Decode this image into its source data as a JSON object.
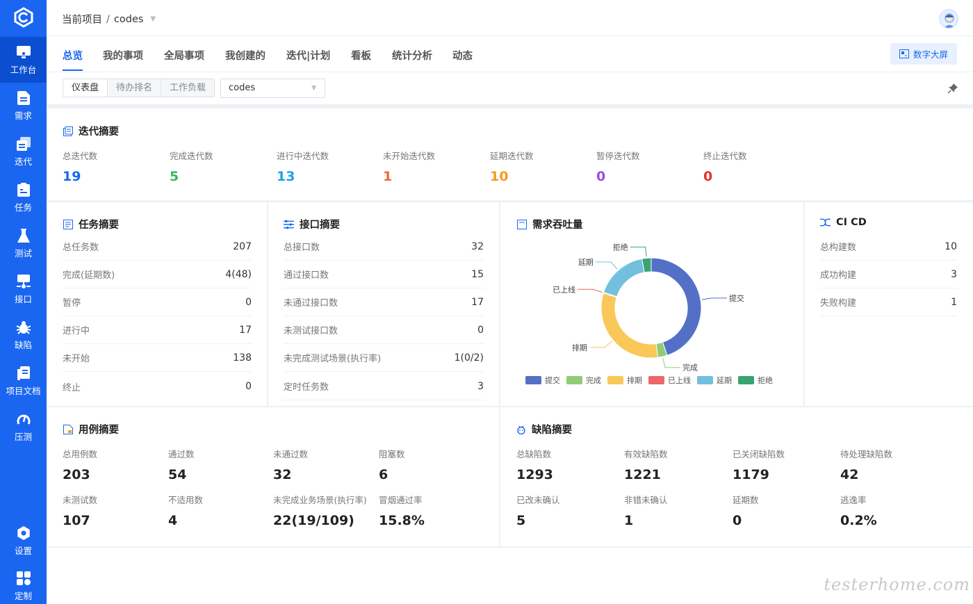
{
  "sidebar": {
    "items": [
      {
        "label": "工作台",
        "icon": "workbench-icon"
      },
      {
        "label": "需求",
        "icon": "requirement-icon"
      },
      {
        "label": "迭代",
        "icon": "iteration-icon"
      },
      {
        "label": "任务",
        "icon": "task-icon"
      },
      {
        "label": "测试",
        "icon": "test-flask-icon"
      },
      {
        "label": "接口",
        "icon": "api-icon"
      },
      {
        "label": "缺陷",
        "icon": "bug-icon"
      },
      {
        "label": "项目文档",
        "icon": "document-icon"
      },
      {
        "label": "压测",
        "icon": "gauge-icon"
      },
      {
        "label": "设置",
        "icon": "settings-icon"
      },
      {
        "label": "定制",
        "icon": "customize-icon"
      }
    ]
  },
  "header": {
    "breadcrumb_root": "当前项目",
    "breadcrumb_sep": "/",
    "project": "codes"
  },
  "tabs": [
    "总览",
    "我的事项",
    "全局事项",
    "我创建的",
    "迭代|计划",
    "看板",
    "统计分析",
    "动态"
  ],
  "screen_button": "数字大屏",
  "filter": {
    "segments": [
      "仪表盘",
      "待办排名",
      "工作负载"
    ],
    "select_value": "codes"
  },
  "iteration_summary": {
    "title": "迭代摘要",
    "stats": [
      {
        "label": "总迭代数",
        "value": "19",
        "color": "#1a66f0"
      },
      {
        "label": "完成迭代数",
        "value": "5",
        "color": "#3bb85a"
      },
      {
        "label": "进行中迭代数",
        "value": "13",
        "color": "#1aa3e8"
      },
      {
        "label": "未开始迭代数",
        "value": "1",
        "color": "#f2692c"
      },
      {
        "label": "延期迭代数",
        "value": "10",
        "color": "#f59a1b"
      },
      {
        "label": "暂停迭代数",
        "value": "0",
        "color": "#9b4ee6"
      },
      {
        "label": "终止迭代数",
        "value": "0",
        "color": "#e8302a"
      }
    ]
  },
  "task_summary": {
    "title": "任务摘要",
    "rows": [
      {
        "k": "总任务数",
        "v": "207"
      },
      {
        "k": "完成(延期数)",
        "v": "4(48)"
      },
      {
        "k": "暂停",
        "v": "0"
      },
      {
        "k": "进行中",
        "v": "17"
      },
      {
        "k": "未开始",
        "v": "138"
      },
      {
        "k": "终止",
        "v": "0"
      }
    ]
  },
  "api_summary": {
    "title": "接口摘要",
    "rows": [
      {
        "k": "总接口数",
        "v": "32"
      },
      {
        "k": "通过接口数",
        "v": "15"
      },
      {
        "k": "未通过接口数",
        "v": "17"
      },
      {
        "k": "未测试接口数",
        "v": "0"
      },
      {
        "k": "未完成测试场景(执行率)",
        "v": "1(0/2)"
      },
      {
        "k": "定时任务数",
        "v": "3"
      }
    ]
  },
  "demand_throughput": {
    "title": "需求吞吐量"
  },
  "chart_data": {
    "type": "pie",
    "donut": true,
    "title": "需求吞吐量",
    "categories": [
      "提交",
      "完成",
      "排期",
      "已上线",
      "延期",
      "拒绝"
    ],
    "values": [
      45,
      3,
      32,
      0.3,
      17,
      3
    ],
    "colors": [
      "#5470c6",
      "#91cc75",
      "#fac858",
      "#ee6666",
      "#73c0de",
      "#3ba272"
    ],
    "legend": "bottom"
  },
  "cicd": {
    "title": "CI CD",
    "rows": [
      {
        "k": "总构建数",
        "v": "10"
      },
      {
        "k": "成功构建",
        "v": "3"
      },
      {
        "k": "失败构建",
        "v": "1"
      }
    ]
  },
  "case_summary": {
    "title": "用例摘要",
    "stats": [
      {
        "label": "总用例数",
        "value": "203"
      },
      {
        "label": "通过数",
        "value": "54"
      },
      {
        "label": "未通过数",
        "value": "32"
      },
      {
        "label": "阻塞数",
        "value": "6"
      },
      {
        "label": "未测试数",
        "value": "107"
      },
      {
        "label": "不适用数",
        "value": "4"
      },
      {
        "label": "未完成业务场景(执行率)",
        "value": "22(19/109)"
      },
      {
        "label": "冒烟通过率",
        "value": "15.8%"
      }
    ]
  },
  "bug_summary": {
    "title": "缺陷摘要",
    "stats": [
      {
        "label": "总缺陷数",
        "value": "1293"
      },
      {
        "label": "有效缺陷数",
        "value": "1221"
      },
      {
        "label": "已关闭缺陷数",
        "value": "1179"
      },
      {
        "label": "待处理缺陷数",
        "value": "42"
      },
      {
        "label": "已改未确认",
        "value": "5"
      },
      {
        "label": "非错未确认",
        "value": "1"
      },
      {
        "label": "延期数",
        "value": "0"
      },
      {
        "label": "逃逸率",
        "value": "0.2%"
      }
    ]
  },
  "watermark": "testerhome.com"
}
